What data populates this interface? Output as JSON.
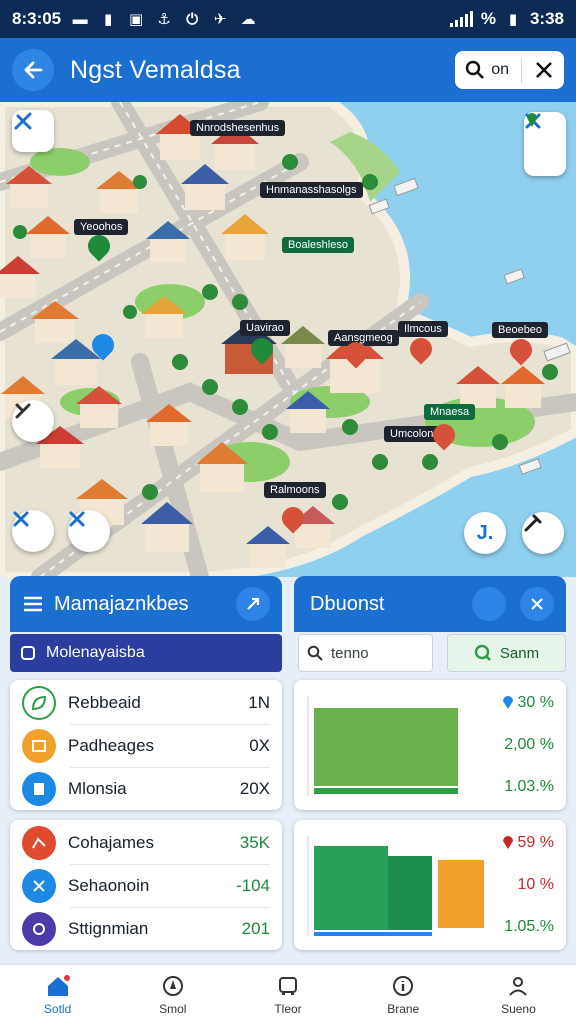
{
  "status": {
    "time": "8:3:05",
    "battery_percent": "%",
    "right_time": "3:38"
  },
  "header": {
    "title": "Ngst Vemaldsa",
    "search_label": "on"
  },
  "map": {
    "labels": [
      {
        "text": "Nnrodshesenhus"
      },
      {
        "text": "Hnmanasshasolgs"
      },
      {
        "text": "Yeoohos"
      },
      {
        "text": "Boaleshleso"
      },
      {
        "text": "Uavirao"
      },
      {
        "text": "Aansgmeog"
      },
      {
        "text": "Ilmcous"
      },
      {
        "text": "Beoebeo"
      },
      {
        "text": "Mnaesa"
      },
      {
        "text": "Umcolonee"
      },
      {
        "text": "Ralmoons"
      }
    ],
    "controls": {
      "topright_text": "✕"
    }
  },
  "left_panel": {
    "title": "Mamajaznkbes",
    "subtitle": "Molenayaisba",
    "group1": [
      {
        "label": "Rebbeaid",
        "value": "1N",
        "icon_color": "#2e9e44",
        "icon": "leaf-icon"
      },
      {
        "label": "Padheages",
        "value": "0X",
        "icon_color": "#f0a12b",
        "icon": "package-icon"
      },
      {
        "label": "Mlonsia",
        "value": "20X",
        "icon_color": "#1e88e5",
        "icon": "calculator-icon"
      }
    ],
    "group2": [
      {
        "label": "Cohajames",
        "value": "35K",
        "icon_color": "#e04a2f",
        "icon": "chart-icon"
      },
      {
        "label": "Sehaonoin",
        "value": "-104",
        "icon_color": "#1e88e5",
        "icon": "scissors-icon"
      },
      {
        "label": "Sttignmian",
        "value": "201",
        "icon_color": "#4b3aa8",
        "icon": "camera-icon"
      }
    ]
  },
  "right_panel": {
    "title": "Dbuonst",
    "search_placeholder": "tenno",
    "search_button": "Sanm",
    "chart1": {
      "pcts": [
        "30 %",
        "2,00 %",
        "1.03.%"
      ],
      "bar_color": "#6ab04c"
    },
    "chart2": {
      "pcts": [
        "59 %",
        "10 %",
        "1.05.%"
      ],
      "bar_colors": [
        "#27a05a",
        "#1e8e4e",
        "#f0a12b"
      ]
    }
  },
  "bottom_nav": [
    {
      "label": "Sotld",
      "icon": "home-icon"
    },
    {
      "label": "Smol",
      "icon": "compass-icon"
    },
    {
      "label": "Tleor",
      "icon": "bus-icon"
    },
    {
      "label": "Brane",
      "icon": "info-icon"
    },
    {
      "label": "Sueno",
      "icon": "profile-icon"
    }
  ]
}
